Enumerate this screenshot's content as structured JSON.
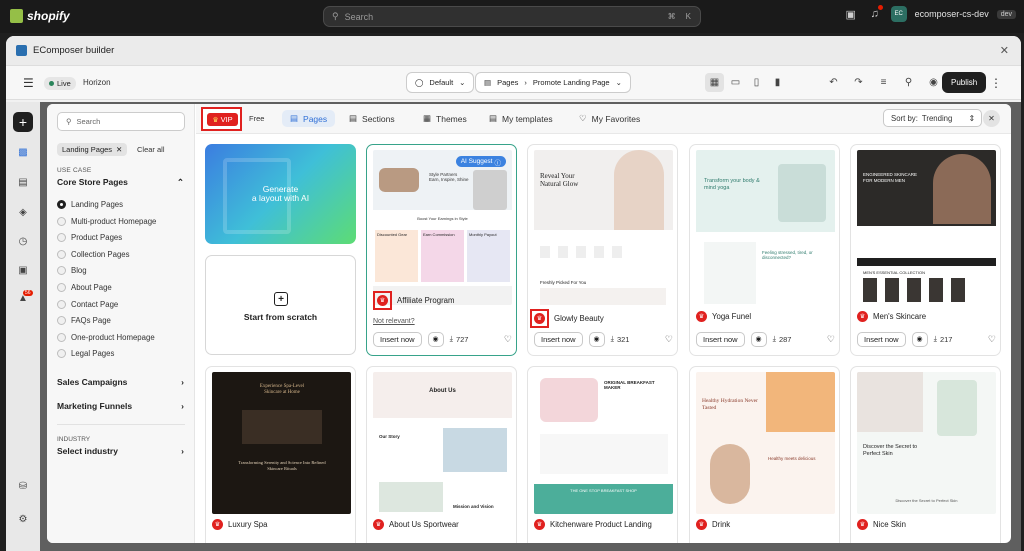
{
  "shopify": {
    "logo_text": "shopify",
    "search_placeholder": "Search",
    "shortcut_1": "⌘",
    "shortcut_2": "K",
    "store_avatar": "EC",
    "store_name": "ecomposer-cs-dev",
    "store_badge": "dev"
  },
  "app": {
    "title": "EComposer builder",
    "live": "Live",
    "theme": "Horizon",
    "default_select": "Default",
    "pages_label": "Pages",
    "page_name": "Promote Landing Page",
    "publish": "Publish",
    "rail_badge": "56"
  },
  "sidebar": {
    "search_placeholder": "Search",
    "active_filter": "Landing Pages",
    "clear_all": "Clear all",
    "use_case_label": "USE CASE",
    "core_group": "Core Store Pages",
    "items": [
      {
        "label": "Landing Pages",
        "selected": true
      },
      {
        "label": "Multi-product Homepage",
        "selected": false
      },
      {
        "label": "Product Pages",
        "selected": false
      },
      {
        "label": "Collection Pages",
        "selected": false
      },
      {
        "label": "Blog",
        "selected": false
      },
      {
        "label": "About Page",
        "selected": false
      },
      {
        "label": "Contact Page",
        "selected": false
      },
      {
        "label": "FAQs Page",
        "selected": false
      },
      {
        "label": "One-product Homepage",
        "selected": false
      },
      {
        "label": "Legal Pages",
        "selected": false
      }
    ],
    "sales_campaigns": "Sales Campaigns",
    "marketing_funnels": "Marketing Funnels",
    "industry_label": "INDUSTRY",
    "industry_select": "Select industry"
  },
  "modal_tabs": {
    "vip": "VIP",
    "free": "Free",
    "pages": "Pages",
    "sections": "Sections",
    "themes": "Themes",
    "my_templates": "My templates",
    "my_favorites": "My Favorites",
    "sort_by": "Sort by:",
    "sort_value": "Trending"
  },
  "ai_card": {
    "line1": "Generate",
    "line2": "a layout with AI"
  },
  "scratch_card": {
    "label": "Start from scratch"
  },
  "templates": [
    {
      "name": "Affiliate Program",
      "downloads": "727",
      "ai_suggest": "AI Suggest",
      "not_relevant": "Not relevant?",
      "insert": "Insert now",
      "thumb_headline": "Style Partners Earn, Inspire, Shine",
      "thumb_sub": "Boost Your Earnings in Style",
      "thumb_cols": [
        "Discounted Gear",
        "Earn Commission",
        "Monthly Payout"
      ]
    },
    {
      "name": "Glowly Beauty",
      "downloads": "321",
      "insert": "Insert now",
      "thumb_headline": "Reveal Your Natural Glow",
      "thumb_sub": "Freshly Picked For You"
    },
    {
      "name": "Yoga Funel",
      "downloads": "287",
      "insert": "Insert now",
      "thumb_headline": "Transform your body & mind yoga",
      "thumb_sub": "Feeling stressed, tired, or disconnected?"
    },
    {
      "name": "Men's Skincare",
      "downloads": "217",
      "insert": "Insert now",
      "thumb_headline": "ENGINEERED SKINCARE FOR MODERN MEN",
      "thumb_sub": "MEN'S ESSENTIAL COLLECTION"
    },
    {
      "name": "Luxury Spa",
      "thumb_headline": "Experience Spa-Level Skincare at Home",
      "thumb_sub": "Transforming Serenity and Science Into Refined Skincare Rituals"
    },
    {
      "name": "About Us Sportwear",
      "thumb_headline": "About Us",
      "thumb_sub": "Our Story",
      "thumb_sub2": "Mission and Vision"
    },
    {
      "name": "Kitchenware Product Landing",
      "thumb_headline": "ORIGINAL BREAKFAST MAKER",
      "thumb_sub": "THE ONE STOP BREAKFAST SHOP"
    },
    {
      "name": "Drink",
      "thumb_headline": "Healthy Hydration Never Tasted",
      "thumb_sub": "Healthy meets delicious"
    },
    {
      "name": "Nice Skin",
      "thumb_headline": "Discover the Secret to Perfect Skin",
      "thumb_sub": "Discover the Secret to Perfect Skin"
    }
  ],
  "colors": {
    "accent": "#e0211f",
    "brand_blue": "#2f6fd6",
    "highlight": "#37a38a"
  },
  "icons": [
    "search-icon",
    "crown-icon",
    "eye-icon",
    "download-icon",
    "heart-icon",
    "close-icon",
    "chevron-down-icon",
    "plus-icon"
  ]
}
